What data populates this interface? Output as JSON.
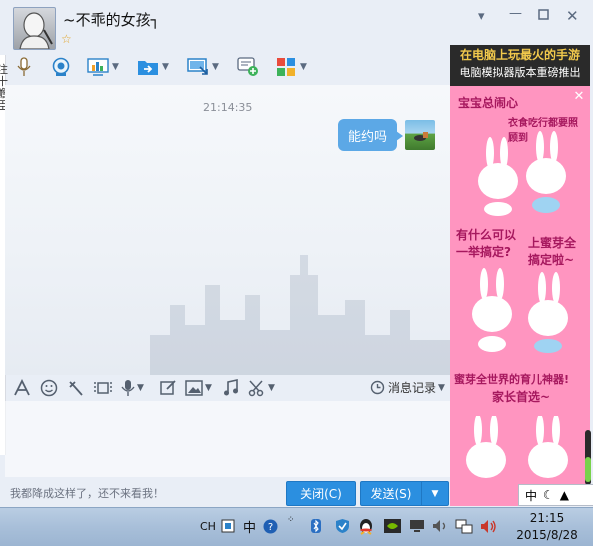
{
  "window": {
    "title": "~不乖的女孩┐",
    "controls": [
      "chevron-down-icon",
      "minimize-icon",
      "maximize-icon",
      "close-icon"
    ]
  },
  "left_strip": {
    "chars": [
      "注",
      "十",
      "瞻",
      "臣"
    ]
  },
  "toolbar": {
    "items": [
      {
        "name": "voice-call",
        "icon": "microphone-icon"
      },
      {
        "name": "video-call",
        "icon": "webcam-icon"
      },
      {
        "name": "app-panel",
        "icon": "chart-screen-icon"
      },
      {
        "name": "file-transfer",
        "icon": "folder-arrow-icon"
      },
      {
        "name": "remote-desktop",
        "icon": "monitor-arrow-icon"
      },
      {
        "name": "invite-discussion",
        "icon": "chat-add-icon"
      },
      {
        "name": "apps",
        "icon": "apps-grid-icon"
      }
    ]
  },
  "chat": {
    "messages": [
      {
        "time": "21:14:35",
        "text": "能约吗",
        "from": "me"
      }
    ]
  },
  "input_toolbar": {
    "history_label": "消息记录"
  },
  "bottom": {
    "hint": "我都降成这样了，还不来看我！",
    "close_label": "关闭(C)",
    "send_label": "发送(S)"
  },
  "ad": {
    "header_line1": "在电脑上玩最火的手游",
    "header_line2": "电脑模拟器版本重磅推出",
    "text1": "宝宝总闹心",
    "text2": "衣食吃行都要照顾到",
    "text3": "有什么可以一举搞定?",
    "text4": "上蜜芽全搞定啦~",
    "text5": "蜜芽全世界的育儿神器!",
    "text6": "家长首选~"
  },
  "ime": {
    "label": "中"
  },
  "taskbar": {
    "lang": "CH",
    "ime_char": "中",
    "clock_time": "21:15",
    "clock_date": "2015/8/28"
  },
  "colors": {
    "accent": "#2b8fe0",
    "bubble": "#5ca8e6",
    "ad_bg": "#ff95c0",
    "window_bg": "#e9eef6"
  }
}
